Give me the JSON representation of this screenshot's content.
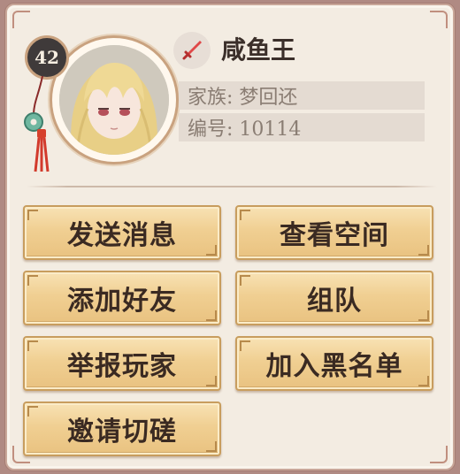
{
  "player": {
    "level": "42",
    "name": "咸鱼王",
    "family_label": "家族: 梦回还",
    "id_label": "编号: 10114"
  },
  "actions": {
    "send_message": "发送消息",
    "view_space": "查看空间",
    "add_friend": "添加好友",
    "team_up": "组队",
    "report_player": "举报玩家",
    "blacklist": "加入黑名单",
    "invite_duel": "邀请切磋"
  },
  "icons": {
    "class_icon": "sword-icon",
    "avatar": "player-portrait",
    "pendant": "jade-pendant-icon"
  },
  "colors": {
    "panel_bg": "#f3ece2",
    "button_gold": "#f0cf92",
    "text_dark": "#3a2a22",
    "accent_red": "#d84a4a"
  }
}
